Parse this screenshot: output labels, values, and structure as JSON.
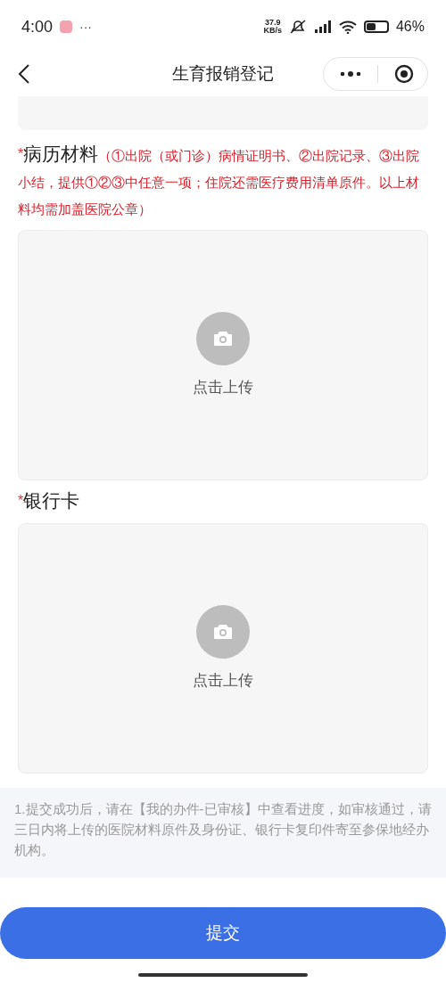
{
  "status_bar": {
    "time": "4:00",
    "more": "···",
    "speed_value": "37.9",
    "speed_unit": "KB/s",
    "battery": "46%"
  },
  "nav": {
    "title": "生育报销登记"
  },
  "sections": [
    {
      "required_mark": "*",
      "label": "病历材料",
      "hint": "（①出院（或门诊）病情证明书、②出院记录、③出院小结，提供①②③中任意一项；住院还需医疗费用清单原件。以上材料均需加盖医院公章）",
      "upload_text": "点击上传"
    },
    {
      "required_mark": "*",
      "label": "银行卡",
      "upload_text": "点击上传"
    }
  ],
  "note": "1.提交成功后，请在【我的办件-已审核】中查看进度，如审核通过，请三日内将上传的医院材料原件及身份证、银行卡复印件寄至参保地经办机构。",
  "submit": "提交"
}
